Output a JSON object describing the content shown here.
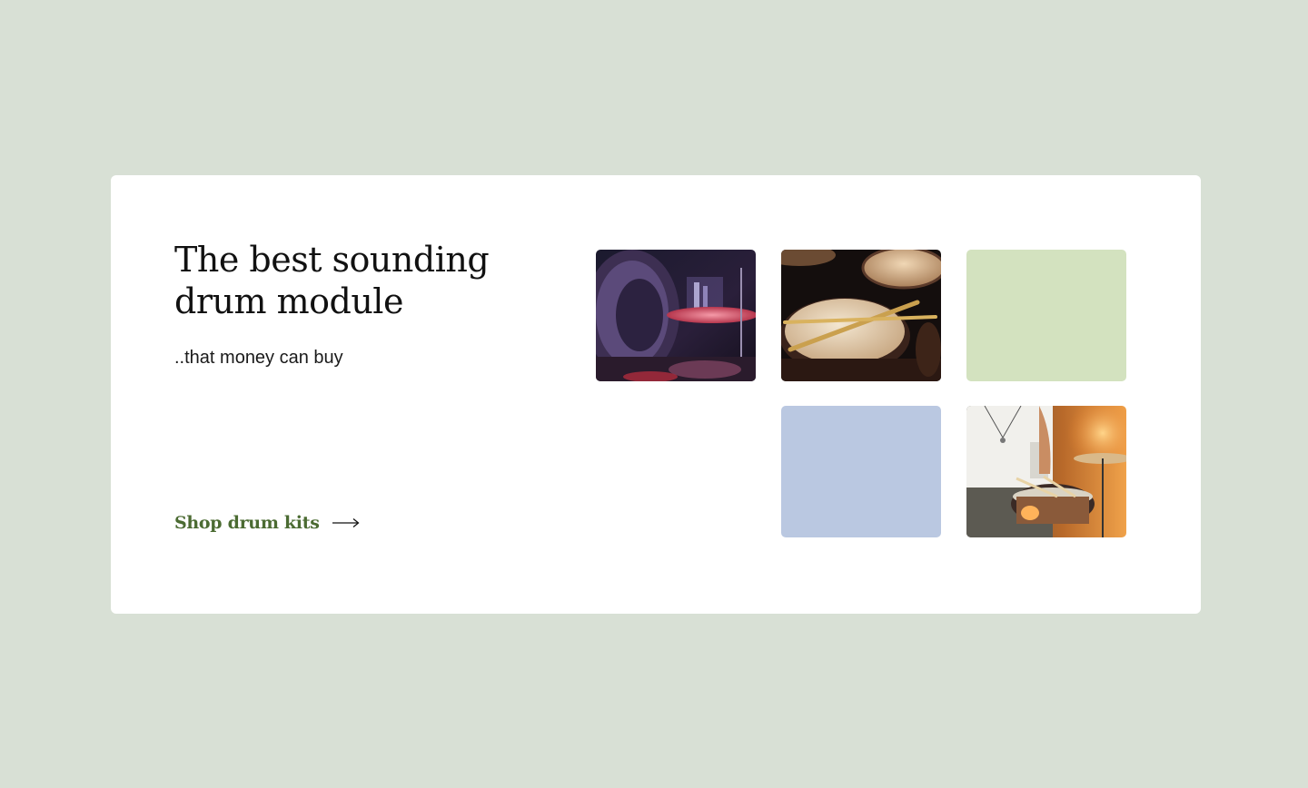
{
  "hero": {
    "headline": "The best sounding drum module",
    "subline": "..that money can buy",
    "cta_label": "Shop drum kits"
  },
  "icons": {
    "cta_arrow": "arrow-right-icon"
  },
  "colors": {
    "page_background": "#d8e0d5",
    "card_background": "#ffffff",
    "cta_text": "#4b6b32",
    "tile_green": "#d3e2bf",
    "tile_blue": "#bac8e1"
  }
}
